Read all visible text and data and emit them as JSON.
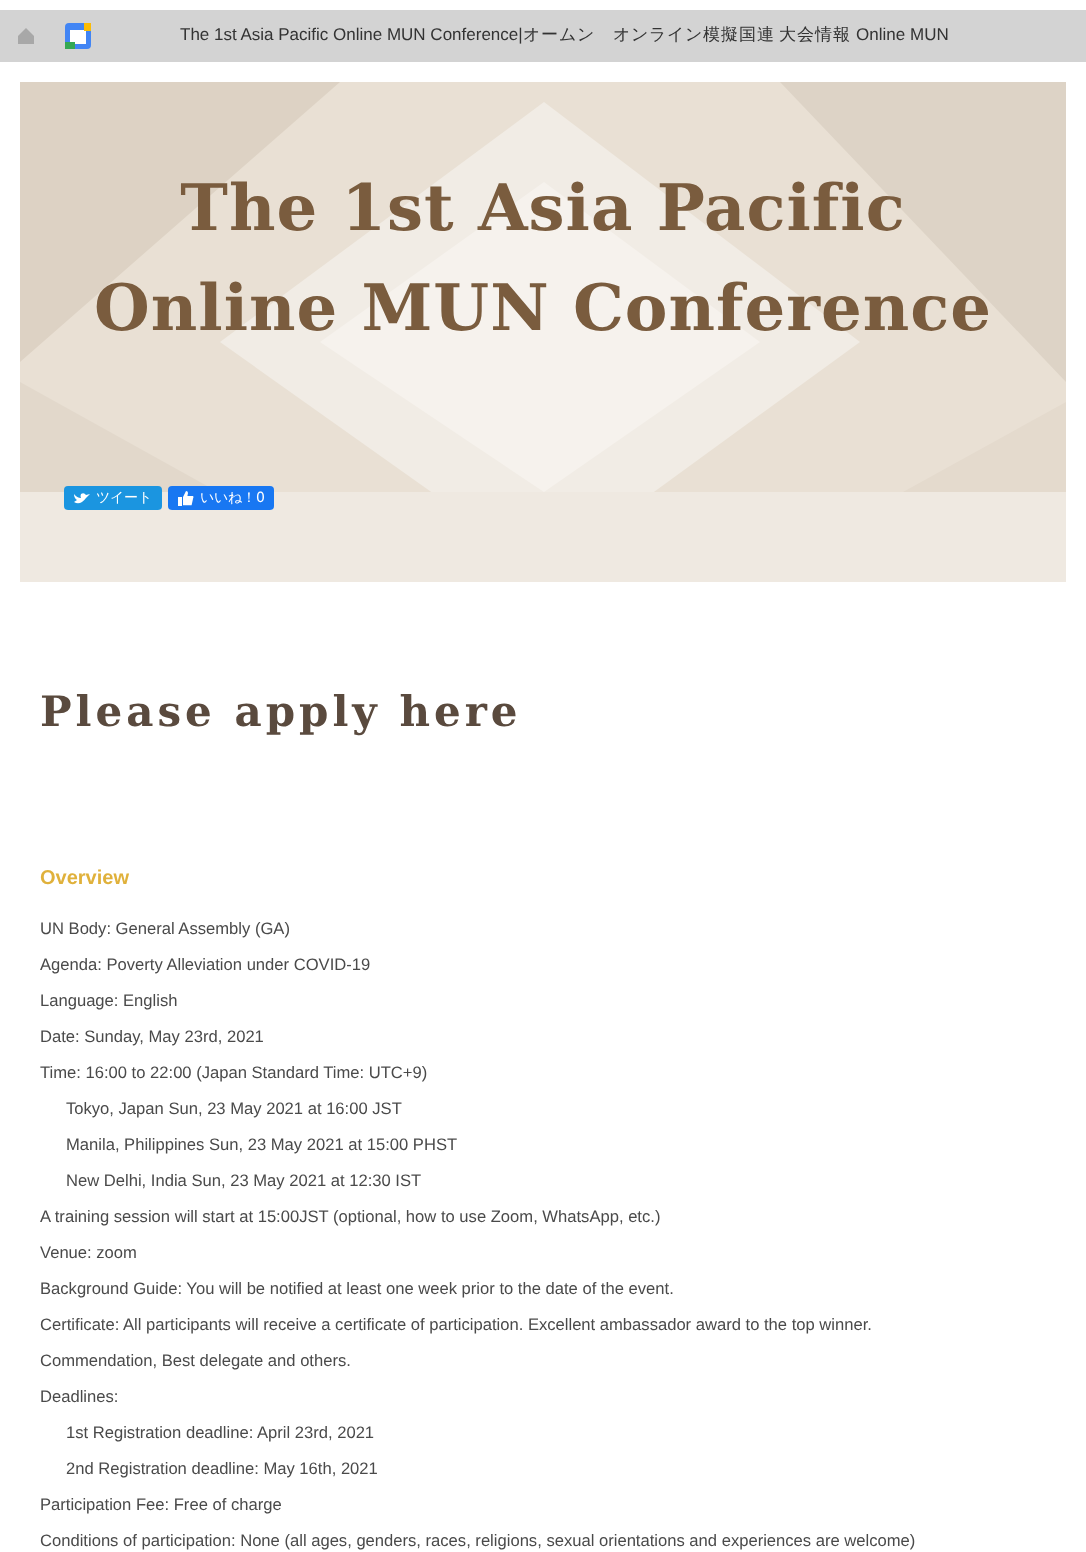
{
  "browser": {
    "tab_title": "The 1st Asia Pacific Online MUN Conference|オームン　オンライン模擬国連 大会情報 Online MUN"
  },
  "hero": {
    "kind": "picture",
    "title_lines": [
      "The 1st Asia Pacific",
      "Online MUN Conference"
    ],
    "share_buttons": [
      {
        "kind": "tweet",
        "label": "ツイート"
      },
      {
        "kind": "like",
        "label": "いいね！0"
      }
    ]
  },
  "apply_heading": "Please apply here",
  "overview": {
    "heading": "Overview",
    "lines": [
      {
        "kind": "main",
        "text": "UN Body: General Assembly (GA)"
      },
      {
        "kind": "main",
        "text": "Agenda: Poverty Alleviation under COVID-19"
      },
      {
        "kind": "main",
        "text": "Language: English"
      },
      {
        "kind": "main",
        "text": "Date: Sunday, May 23rd, 2021"
      },
      {
        "kind": "main",
        "text": "Time: 16:00 to 22:00 (Japan Standard Time: UTC+9)"
      },
      {
        "kind": "sub",
        "text": "Tokyo, Japan Sun, 23 May 2021 at 16:00 JST"
      },
      {
        "kind": "sub",
        "text": "Manila, Philippines Sun, 23 May 2021 at 15:00 PHST"
      },
      {
        "kind": "sub",
        "text": "New Delhi, India Sun, 23 May 2021 at 12:30 IST"
      },
      {
        "kind": "main",
        "text": "A training session will start at 15:00JST (optional, how to use Zoom, WhatsApp, etc.)"
      },
      {
        "kind": "main",
        "text": "Venue: zoom"
      },
      {
        "kind": "main",
        "text": "Background Guide: You will be notified at least one week prior to the date of the event."
      },
      {
        "kind": "main",
        "text": "Certificate: All participants will receive a certificate of participation. Excellent ambassador award to the top winner."
      },
      {
        "kind": "main",
        "text": "Commendation, Best delegate and others."
      },
      {
        "kind": "main",
        "text": "Deadlines:"
      },
      {
        "kind": "sub",
        "text": "1st Registration deadline: April 23rd, 2021"
      },
      {
        "kind": "sub",
        "text": "2nd Registration deadline: May 16th, 2021"
      },
      {
        "kind": "main",
        "text": "Participation Fee: Free of charge"
      },
      {
        "kind": "main",
        "text": "Conditions of participation: None (all ages, genders, races, religions, sexual orientations and experiences are welcome)"
      }
    ]
  }
}
